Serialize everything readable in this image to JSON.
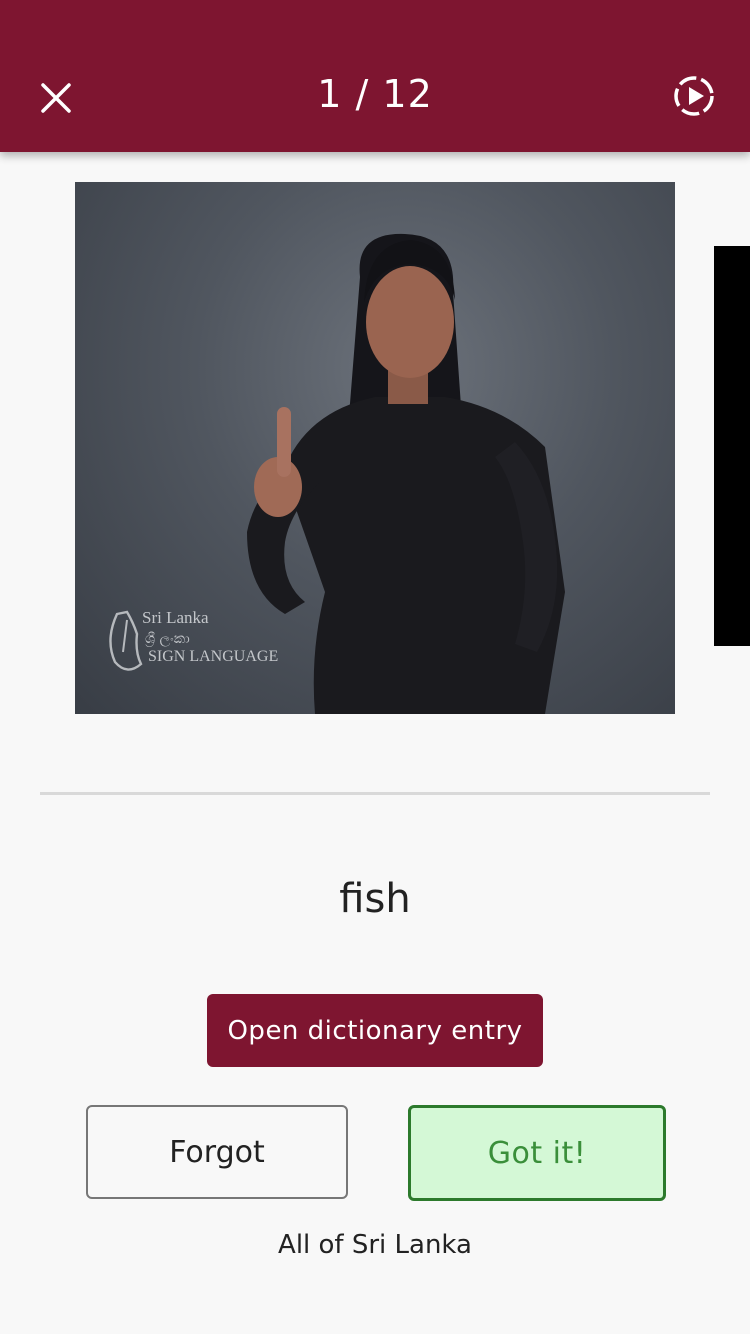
{
  "header": {
    "progress": "1 / 12",
    "close_icon": "close-icon",
    "play_icon": "play-circle-dashed-icon",
    "bar_color": "#7e1530"
  },
  "video": {
    "watermark_title": "Sri Lanka",
    "watermark_script": "ශ්‍රී ලංකා",
    "watermark_subtitle": "SIGN LANGUAGE"
  },
  "card": {
    "word": "fish",
    "open_entry_label": "Open dictionary entry",
    "forgot_label": "Forgot",
    "got_it_label": "Got it!",
    "region": "All of Sri Lanka"
  },
  "colors": {
    "accent": "#7e1530",
    "success_bg": "#d4f8d6",
    "success_border": "#2c7a2c",
    "success_text": "#3a8f3a"
  }
}
